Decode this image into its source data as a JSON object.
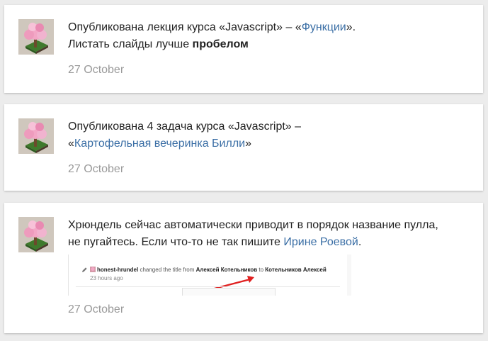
{
  "feed": [
    {
      "text_before": "Опубликована лекция курса «Javascript» – «",
      "link": "Функции",
      "text_after": "».",
      "line2_before": "Листать слайды лучше ",
      "line2_bold": "пробелом",
      "date": "27 October"
    },
    {
      "text_before": "Опубликована 4 задача курса «Javascript» –",
      "line2_before": "«",
      "link": "Картофельная вечеринка Билли",
      "line2_after": "»",
      "date": "27 October"
    },
    {
      "line1": "Хрюндель сейчас автоматически приводит в порядок название пулла,",
      "line2_before": "не пугайтесь. Если что-то не так пишите ",
      "link": "Ирине Роевой",
      "line2_after": ".",
      "screenshot": {
        "user": "honest-hrundel",
        "action": " changed the title from ",
        "old_title": "Алексей Котельников",
        "to": " to ",
        "new_title": "Котельников Алексей",
        "time": "23 hours ago"
      },
      "date": "27 October"
    }
  ],
  "colors": {
    "link": "#3a6ea5",
    "date": "#9a9a9a",
    "background": "#ececec",
    "arrow": "#e02020"
  },
  "icons": {
    "avatar": "pink-tree-voxel-avatar",
    "edit": "pencil-icon"
  }
}
